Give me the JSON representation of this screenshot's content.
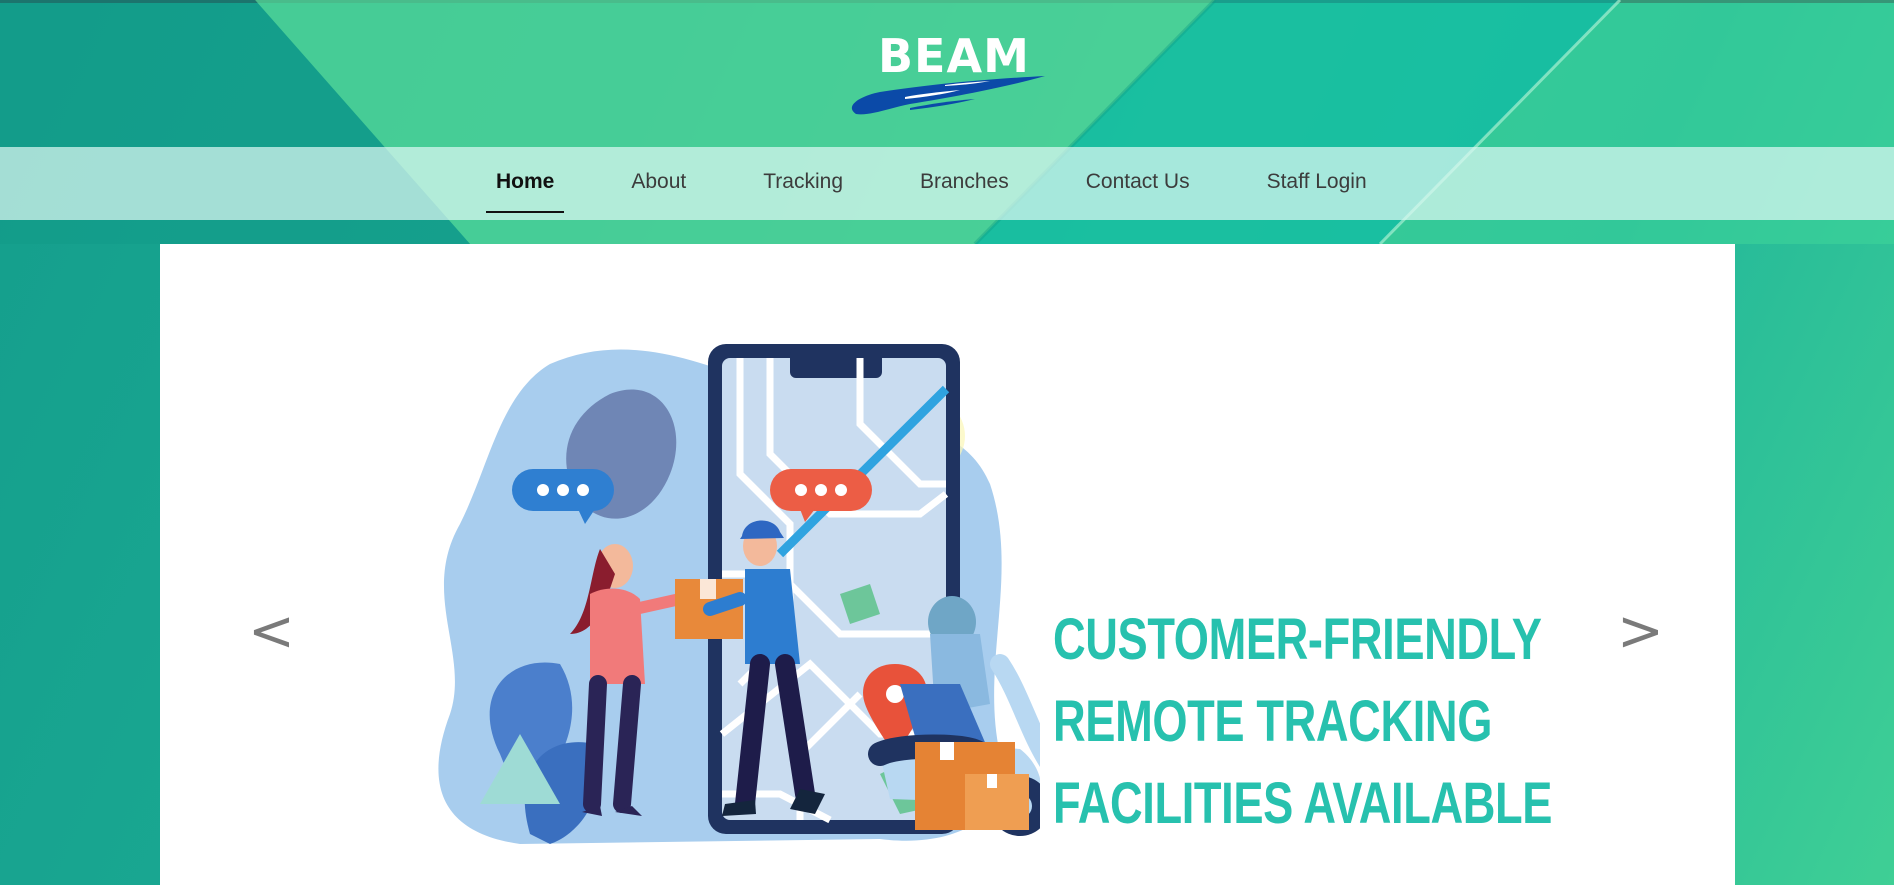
{
  "header": {
    "logo_text": "BEAM"
  },
  "nav": {
    "items": [
      {
        "label": "Home",
        "active": true
      },
      {
        "label": "About"
      },
      {
        "label": "Tracking"
      },
      {
        "label": "Branches"
      },
      {
        "label": "Contact Us"
      },
      {
        "label": "Staff Login"
      }
    ]
  },
  "slider": {
    "prev_label": "<",
    "next_label": ">",
    "headline": [
      "CUSTOMER-FRIENDLY",
      "REMOTE TRACKING",
      "FACILITIES AVAILABLE"
    ]
  },
  "colors": {
    "accent": "#27c1ae",
    "logo_swoosh": "#0b4aa8",
    "page_bg": "#1aa892"
  }
}
